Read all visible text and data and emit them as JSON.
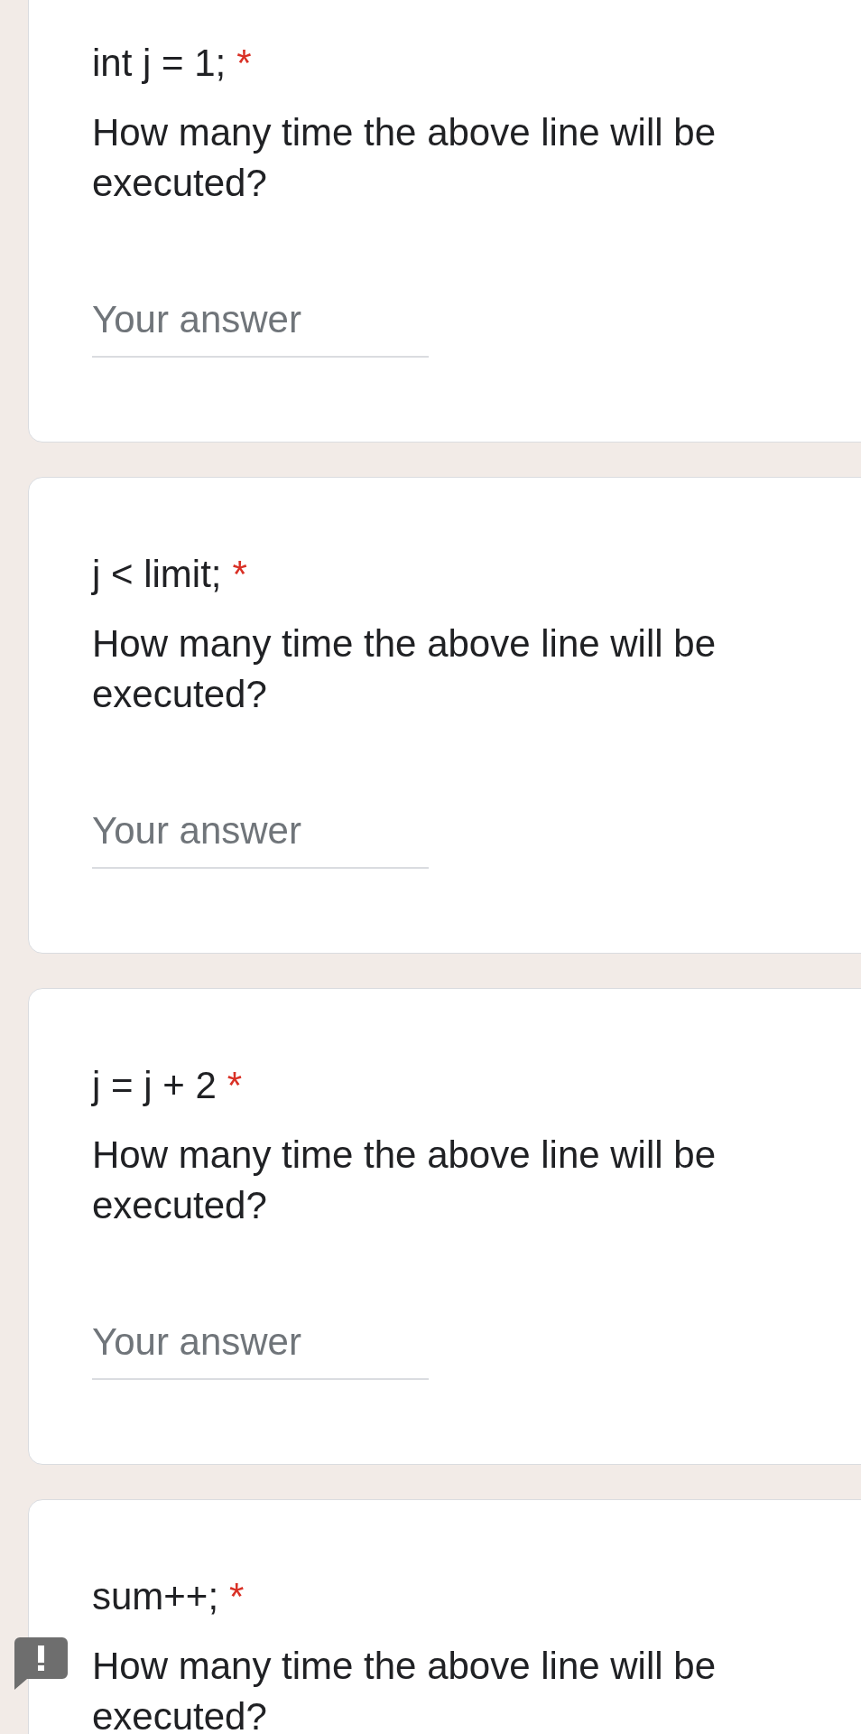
{
  "questions": [
    {
      "title": "int j = 1;",
      "required_mark": "*",
      "description": "How many time the above line will be executed?",
      "answer": {
        "placeholder": "Your answer"
      },
      "alert": false
    },
    {
      "title": "j < limit;",
      "required_mark": "*",
      "description": "How many time the above line will be executed?",
      "answer": {
        "placeholder": "Your answer"
      },
      "alert": false
    },
    {
      "title": "j = j + 2",
      "required_mark": "*",
      "description": "How many time the above line will be executed?",
      "answer": {
        "placeholder": "Your answer"
      },
      "alert": false
    },
    {
      "title": "sum++;",
      "required_mark": "*",
      "description": "How many time the above line will be executed?",
      "alert": true
    }
  ]
}
